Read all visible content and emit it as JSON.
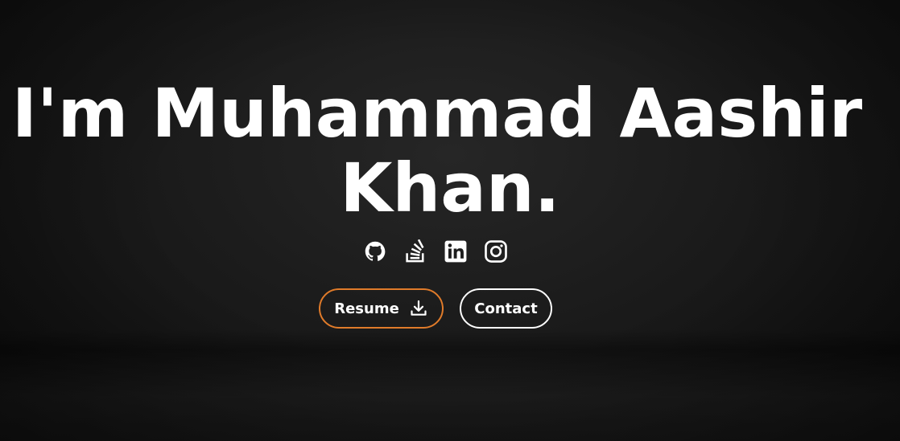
{
  "hero": {
    "title_line_1": "I'm Muhammad Aashir",
    "title_line_2": "Khan."
  },
  "social_links": [
    {
      "name": "github",
      "icon": "github-icon"
    },
    {
      "name": "stackoverflow",
      "icon": "stackoverflow-icon"
    },
    {
      "name": "linkedin",
      "icon": "linkedin-icon"
    },
    {
      "name": "instagram",
      "icon": "instagram-icon"
    }
  ],
  "buttons": {
    "resume_label": "Resume",
    "resume_icon": "download-icon",
    "contact_label": "Contact"
  },
  "colors": {
    "background": "#1c1c1c",
    "text": "#ffffff",
    "accent": "#e07b2a"
  }
}
